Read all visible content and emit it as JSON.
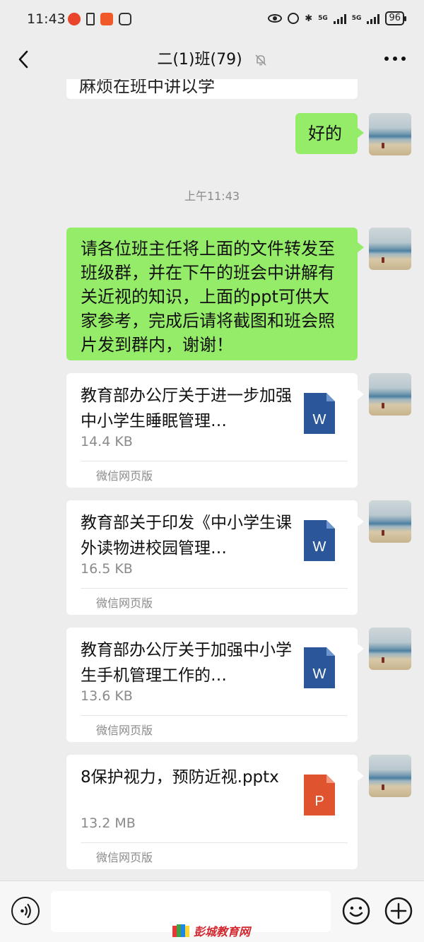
{
  "status_bar": {
    "time": "11:43",
    "network_1": "5G",
    "network_2": "5G",
    "battery": "96"
  },
  "header": {
    "title": "二(1)班(79)",
    "back_icon": "chevron-left-icon",
    "mute_icon": "bell-off-icon",
    "more_icon": "more-horizontal-icon"
  },
  "messages": {
    "partial_text": "麻烦在班中讲以学",
    "reply_ok": "好的",
    "timestamp": "上午11:43",
    "notice_text": "请各位班主任将上面的文件转发至班级群，并在下午的班会中讲解有关近视的知识，上面的ppt可供大家参考，完成后请将截图和班会照片发到群内，谢谢！",
    "files": [
      {
        "title": "教育部办公厅关于进一步加强中小学生睡眠管理…",
        "size": "14.4 KB",
        "source": "微信网页版",
        "icon_label": "W",
        "icon_color": "#2b579a"
      },
      {
        "title": "教育部关于印发《中小学生课外读物进校园管理…",
        "size": "16.5 KB",
        "source": "微信网页版",
        "icon_label": "W",
        "icon_color": "#2b579a"
      },
      {
        "title": "教育部办公厅关于加强中小学生手机管理工作的…",
        "size": "13.6 KB",
        "source": "微信网页版",
        "icon_label": "W",
        "icon_color": "#2b579a"
      },
      {
        "title": "8保护视力，预防近视.pptx",
        "size": "13.2 MB",
        "source": "微信网页版",
        "icon_label": "P",
        "icon_color": "#e0532f"
      }
    ]
  },
  "input_bar": {
    "voice_icon": "voice-icon",
    "emoji_icon": "emoji-icon",
    "plus_icon": "plus-circle-icon"
  },
  "watermark": {
    "text": "彭城教育网"
  },
  "colors": {
    "background": "#ededed",
    "sent_bubble": "#95ec69",
    "file_card": "#ffffff"
  }
}
